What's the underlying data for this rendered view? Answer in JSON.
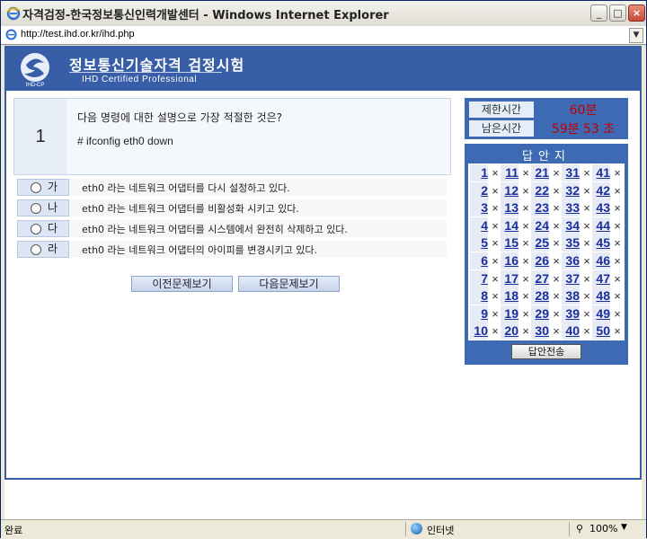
{
  "window": {
    "title": "자격검정-한국정보통신인력개발센터 - Windows Internet Explorer",
    "address": "http://test.ihd.or.kr/ihd.php"
  },
  "banner": {
    "title_kr": "정보통신기술자격 검정시험",
    "title_en": "IHD Certified Professional",
    "logo_text": "IHD-CP"
  },
  "question": {
    "number": "1",
    "text": "다음 명령에 대한 설명으로 가장 적절한 것은?",
    "command": "# ifconfig eth0 down"
  },
  "options": [
    {
      "letter": "가",
      "text": "eth0 라는 네트워크 어댑터를 다시 설정하고 있다."
    },
    {
      "letter": "나",
      "text": "eth0 라는 네트워크 어댑터를 비활성화 시키고 있다."
    },
    {
      "letter": "다",
      "text": "eth0 라는 네트워크 어댑터를 시스템에서 완전히 삭제하고 있다."
    },
    {
      "letter": "라",
      "text": "eth0 라는 네트워크 어댑터의 아이피를 변경시키고 있다."
    }
  ],
  "nav": {
    "prev": "이전문제보기",
    "next": "다음문제보기"
  },
  "timer": {
    "limit_label": "제한시간",
    "limit_value": "60분",
    "remain_label": "남은시간",
    "remain_value": "59분 53 초"
  },
  "answer_sheet": {
    "title": "답안지",
    "mark": "×",
    "numbers": [
      1,
      2,
      3,
      4,
      5,
      6,
      7,
      8,
      9,
      10,
      11,
      12,
      13,
      14,
      15,
      16,
      17,
      18,
      19,
      20,
      21,
      22,
      23,
      24,
      25,
      26,
      27,
      28,
      29,
      30,
      31,
      32,
      33,
      34,
      35,
      36,
      37,
      38,
      39,
      40,
      41,
      42,
      43,
      44,
      45,
      46,
      47,
      48,
      49,
      50
    ],
    "submit": "답안전송"
  },
  "status": {
    "text": "완료",
    "zone": "인터넷",
    "zoom": "100%"
  },
  "colors": {
    "banner": "#375ea6",
    "panel": "#3d6ab2",
    "timer_value": "#c00000",
    "answer_number": "#1a2f9c"
  }
}
